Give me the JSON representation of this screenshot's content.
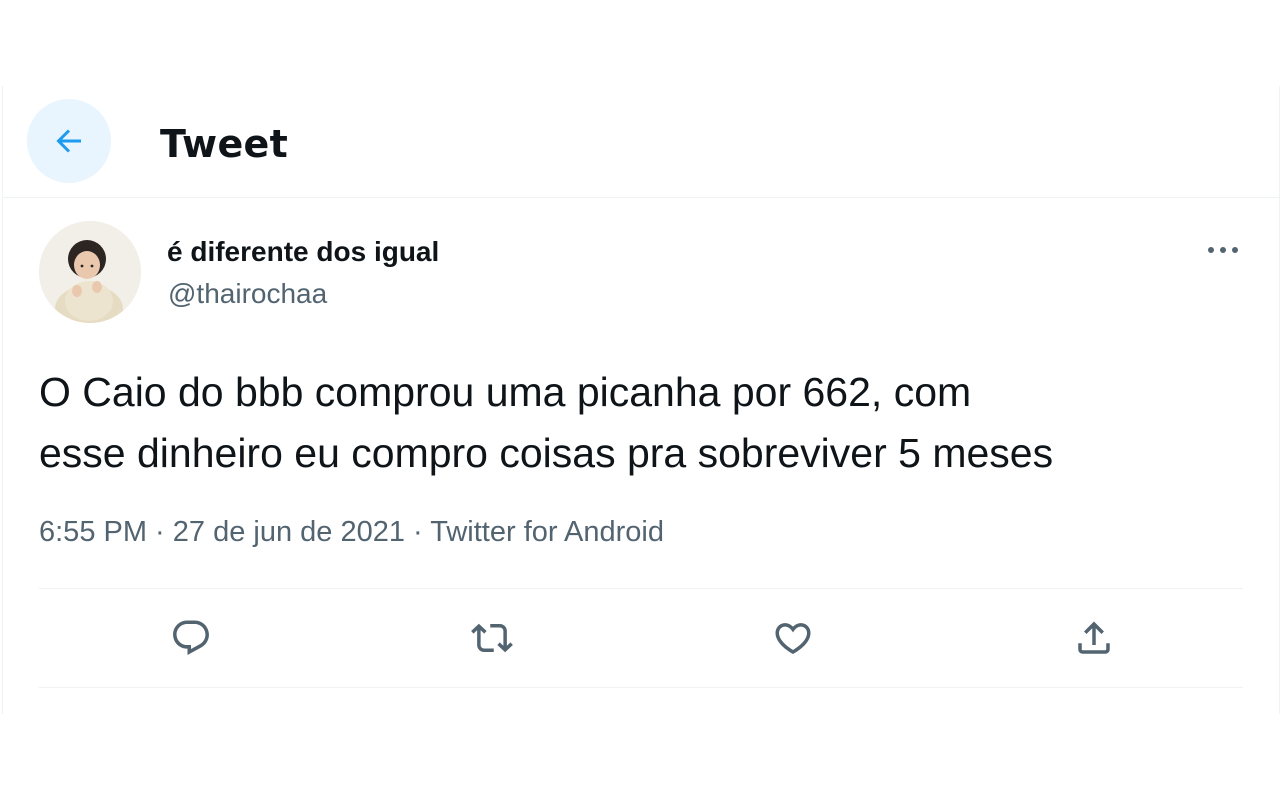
{
  "header": {
    "title": "Tweet",
    "back_icon": "arrow-left-icon"
  },
  "colors": {
    "accent": "#1d9bf0",
    "back_bg": "#e8f5fe",
    "text": "#0f1419",
    "secondary_text": "#536471",
    "border": "#eff3f4"
  },
  "tweet": {
    "display_name": "é diferente dos igual",
    "handle": "@thairochaa",
    "avatar_icon": "avatar-photo",
    "more_icon": "more-horizontal-icon",
    "text": "O Caio do bbb comprou uma picanha por 662, com\nesse dinheiro eu compro coisas pra sobreviver 5 meses",
    "time": "6:55 PM",
    "separator": " · ",
    "date": "27 de jun de 2021",
    "source": "Twitter for Android"
  },
  "actions": [
    {
      "name": "reply",
      "icon": "reply-icon"
    },
    {
      "name": "retweet",
      "icon": "retweet-icon"
    },
    {
      "name": "like",
      "icon": "heart-icon"
    },
    {
      "name": "share",
      "icon": "share-icon"
    }
  ]
}
